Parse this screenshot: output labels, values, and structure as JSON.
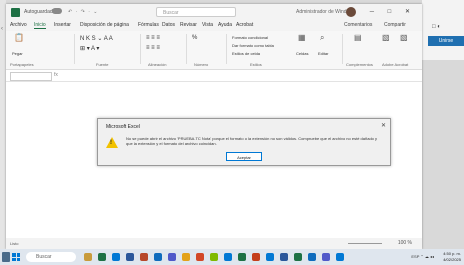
{
  "window": {
    "autosave_label": "Autoguardado",
    "qat": "↶ · ↷ · ⌄",
    "search_placeholder": "Buscar",
    "user_name": "Administrador de Windows",
    "controls": "─ □ ✕"
  },
  "menu": {
    "items": [
      "Archivo",
      "Inicio",
      "Insertar",
      "Disposición de página",
      "Fórmulas",
      "Datos",
      "Revisar",
      "Vista",
      "Ayuda",
      "Acrobat"
    ],
    "active_index": 1,
    "comments": "Comentarios",
    "share": "Compartir"
  },
  "ribbon": {
    "paste": "Pegar",
    "clipboard": "Portapapeles",
    "font": "Fuente",
    "alignment": "Alineación",
    "number": "Número",
    "number_format": "%",
    "conditional_format": "Formato condicional",
    "format_as_table": "Dar formato como tabla",
    "cell_styles": "Estilos de celda",
    "styles": "Estilos",
    "cells": "Celdas",
    "editing": "Editar",
    "analyze": "Complementos",
    "pdf_create": "Crear PDF y compartir vínculo",
    "pdf_share": "Crear PDF y compartir con Outlook",
    "adobe": "Adobe Acrobat"
  },
  "formula_bar": {
    "fx": "fx"
  },
  "status": {
    "left": "Listo",
    "zoom": "100 %"
  },
  "dialog": {
    "title": "Microsoft Excel",
    "message": "No se puede abrir el archivo 'PRUEBA.TC Nota' porque el formato o la extensión no son válidos. Compruebe que el archivo no esté dañado y que la extensión y el formato del archivo coincidan.",
    "button": "Aceptar"
  },
  "taskbar": {
    "search_placeholder": "Buscar",
    "tray": "ESP  ⌃ ☁ ◂◂",
    "time": "4:50 p. m.",
    "date": "4/02/2025"
  },
  "background_app": {
    "button_label": "Unirse",
    "icons": "□ ◐"
  },
  "colors": {
    "excel_green": "#1e7145",
    "accent_blue": "#0078d4",
    "warning_yellow": "#f2c200"
  }
}
